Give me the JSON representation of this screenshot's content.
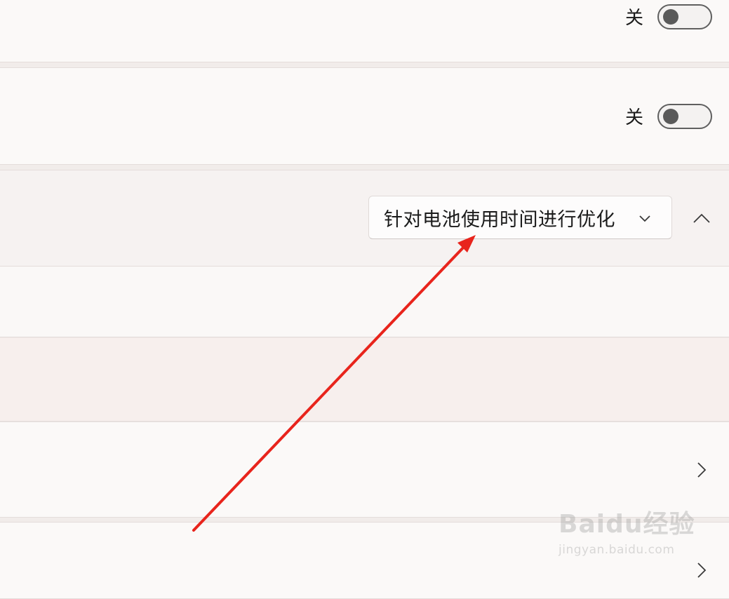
{
  "settings": {
    "row1": {
      "toggle_label": "关"
    },
    "row2": {
      "toggle_label": "关"
    },
    "power_mode": {
      "selected": "针对电池使用时间进行优化",
      "icons": {
        "dropdown": "chevron-down-icon",
        "collapse": "chevron-up-icon"
      }
    },
    "row_nav": {
      "icon": "chevron-right-icon"
    }
  },
  "watermark": {
    "logo": "Baidu经验",
    "url": "jingyan.baidu.com"
  },
  "annotation": {
    "color": "#e8241c"
  }
}
